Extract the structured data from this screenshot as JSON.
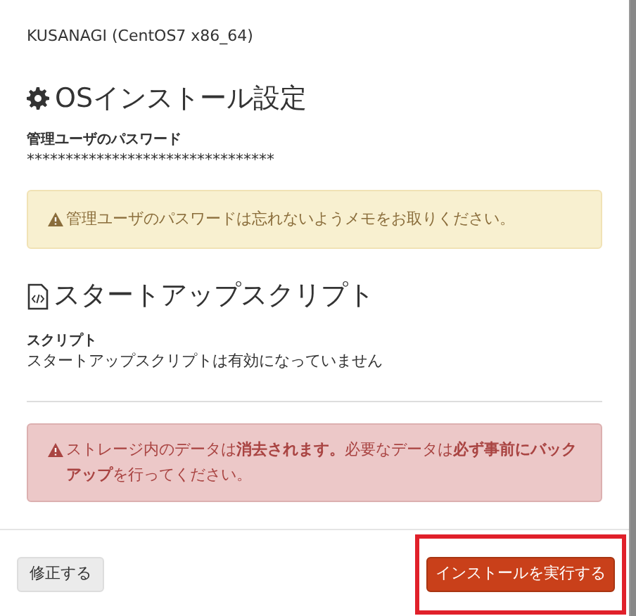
{
  "os": {
    "value": "KUSANAGI (CentOS7 x86_64)"
  },
  "os_settings": {
    "heading": "OSインストール設定",
    "fields": [
      {
        "label": "管理ユーザのパスワード",
        "value": "********************************"
      }
    ],
    "alert": {
      "kind": "warning",
      "text": "管理ユーザのパスワードは忘れないようメモをお取りください。"
    }
  },
  "startup_script": {
    "heading": "スタートアップスクリプト",
    "fields": [
      {
        "label": "スクリプト",
        "value": "スタートアップスクリプトは有効になっていません"
      }
    ]
  },
  "danger_alert": {
    "kind": "danger",
    "text": "ストレージ内のデータは**消去されます。**必要なデータは**必ず事前にバックアップ**を行ってください。"
  },
  "footer": {
    "buttons": [
      {
        "label": "修正する",
        "kind": "default",
        "highlighted": false
      },
      {
        "label": "インストールを実行する",
        "kind": "primary",
        "highlighted": true
      }
    ]
  }
}
